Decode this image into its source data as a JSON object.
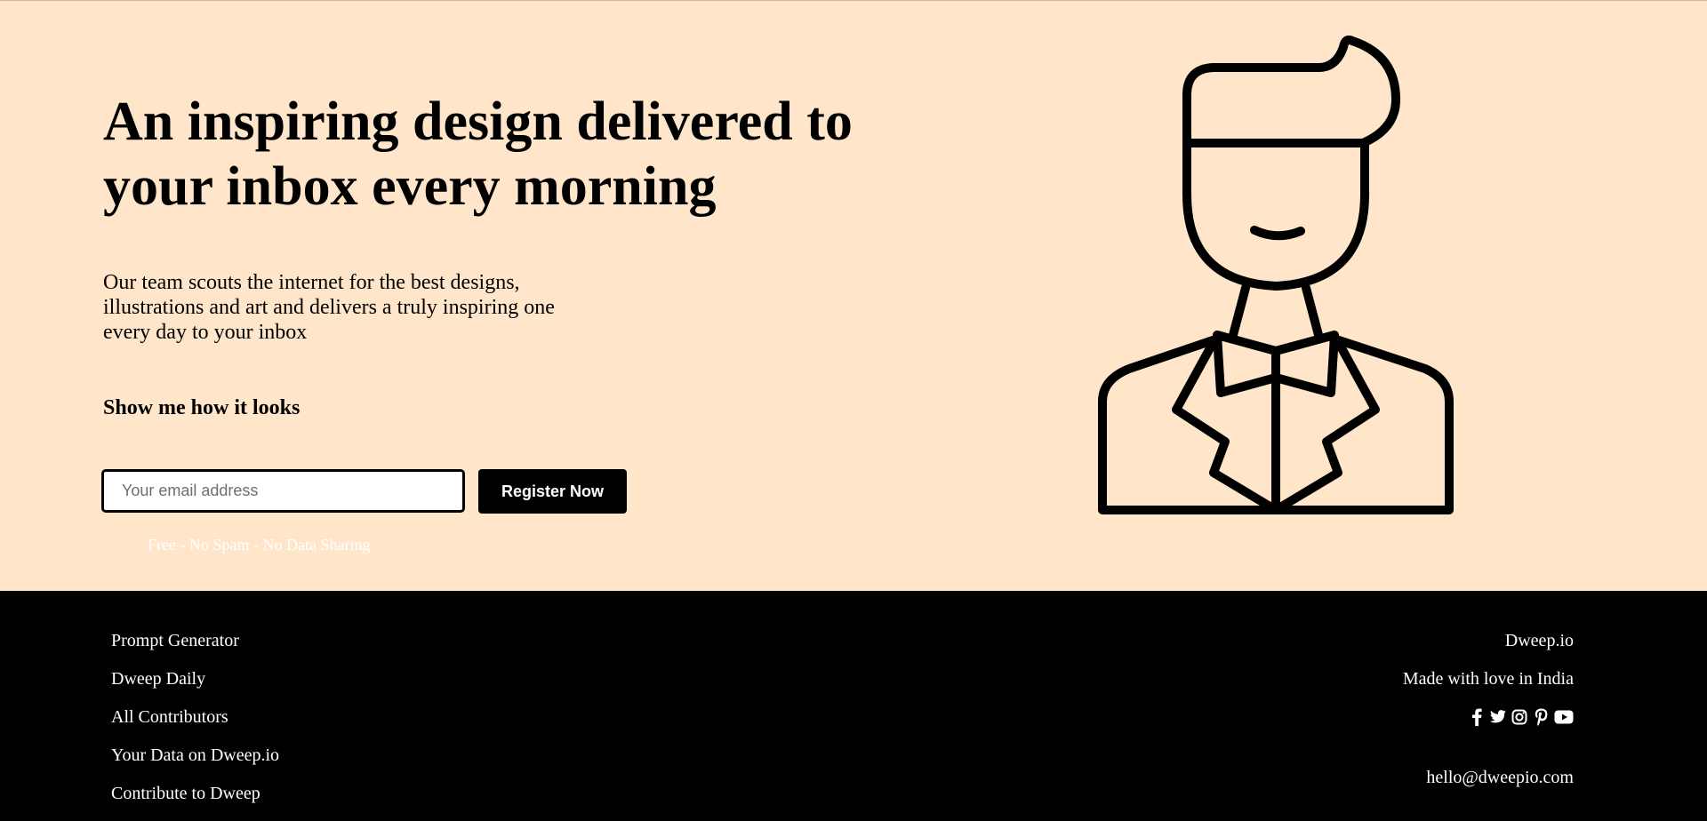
{
  "hero": {
    "headline": "An inspiring design delivered to your inbox every morning",
    "description": "Our team scouts the internet for the best designs, illustrations and art and delivers a truly inspiring one every day to your inbox",
    "show_link": "Show me how it looks",
    "email_placeholder": "Your email address",
    "register_label": "Register Now",
    "fine_print": "Free - No Spam - No Data Sharing",
    "illustration_icon": "man-with-bowtie-line-illustration"
  },
  "footer": {
    "links": [
      "Prompt Generator",
      "Dweep Daily",
      "All Contributors",
      "Your Data on Dweep.io",
      "Contribute to Dweep"
    ],
    "brand": "Dweep.io",
    "tagline": "Made with love in India",
    "social_icons": [
      "facebook-icon",
      "twitter-icon",
      "instagram-icon",
      "pinterest-icon",
      "youtube-icon"
    ],
    "email": "hello@dweepio.com"
  },
  "colors": {
    "background": "#ffe6cb",
    "footer": "#000000",
    "button": "#000000"
  }
}
